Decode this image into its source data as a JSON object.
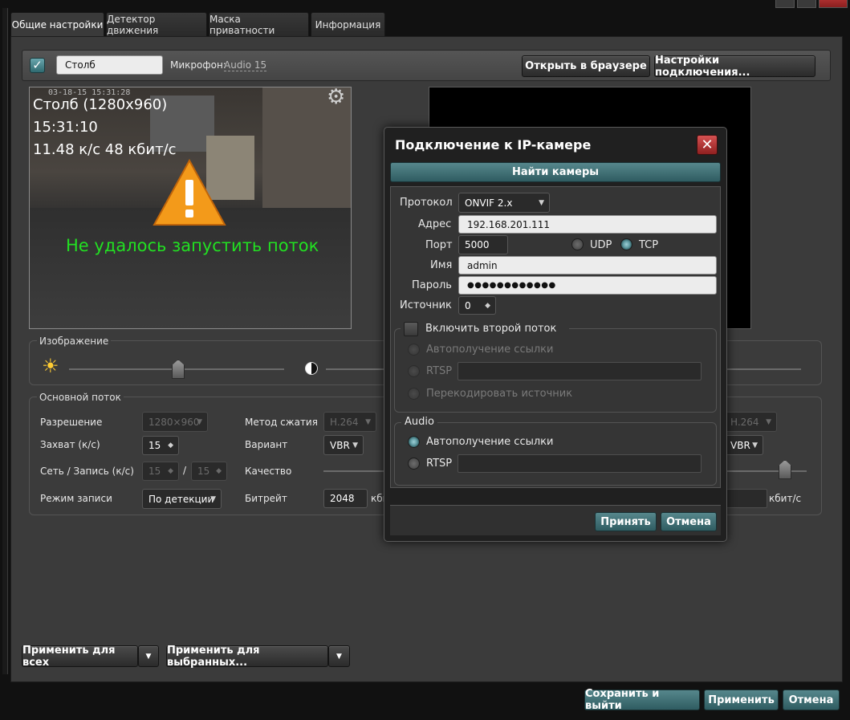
{
  "tabs": [
    "Общие настройки",
    "Детектор движения",
    "Маска приватности",
    "Информация"
  ],
  "camera": {
    "name": "Столб",
    "mic_label": "Микрофон:",
    "mic_value": "Audio 15",
    "open_browser": "Открыть в браузере",
    "connection_settings": "Настройки подключения..."
  },
  "preview": {
    "title": "Столб (1280x960)",
    "time": "15:31:10",
    "stats": "11.48 к/с 48 кбит/с",
    "overlay_stamp": "03-18-15 15:31:28",
    "error": "Не удалось запустить поток"
  },
  "image_section": {
    "title": "Изображение"
  },
  "main_stream": {
    "title": "Основной поток",
    "resolution_label": "Разрешение",
    "resolution_value": "1280×960",
    "fps_label": "Захват (к/с)",
    "fps_value": "15",
    "net_rec_label": "Сеть / Запись (к/с)",
    "net_value": "15",
    "slash": "/",
    "rec_value": "15",
    "rec_mode_label": "Режим записи",
    "rec_mode_value": "По детекции",
    "codec_label": "Метод сжатия",
    "codec_value": "H.264",
    "variant_label": "Вариант",
    "variant_value": "VBR",
    "quality_label": "Качество",
    "bitrate_label": "Битрейт",
    "bitrate_value": "2048",
    "bitrate_unit_partial": "кби",
    "codec2_value": "H.264",
    "variant2_value": "VBR",
    "bitrate_unit": "кбит/с"
  },
  "bottom": {
    "apply_all": "Применить для всех",
    "apply_selected": "Применить для выбранных...",
    "save_exit": "Сохранить и выйти",
    "apply": "Применить",
    "cancel": "Отмена"
  },
  "dialog": {
    "title": "Подключение к IP-камере",
    "find": "Найти камеры",
    "protocol_label": "Протокол",
    "protocol_value": "ONVIF 2.x",
    "address_label": "Адрес",
    "address_value": "192.168.201.111",
    "port_label": "Порт",
    "port_value": "5000",
    "udp": "UDP",
    "tcp": "TCP",
    "name_label": "Имя",
    "name_value": "admin",
    "password_label": "Пароль",
    "password_value": "●●●●●●●●●●●●",
    "source_label": "Источник",
    "source_value": "0",
    "second_stream": "Включить второй поток",
    "auto_link": "Автополучение ссылки",
    "rtsp": "RTSP",
    "transcode": "Перекодировать источник",
    "audio_title": "Audio",
    "audio_auto": "Автополучение ссылки",
    "audio_rtsp": "RTSP",
    "accept": "Принять",
    "cancel": "Отмена"
  }
}
